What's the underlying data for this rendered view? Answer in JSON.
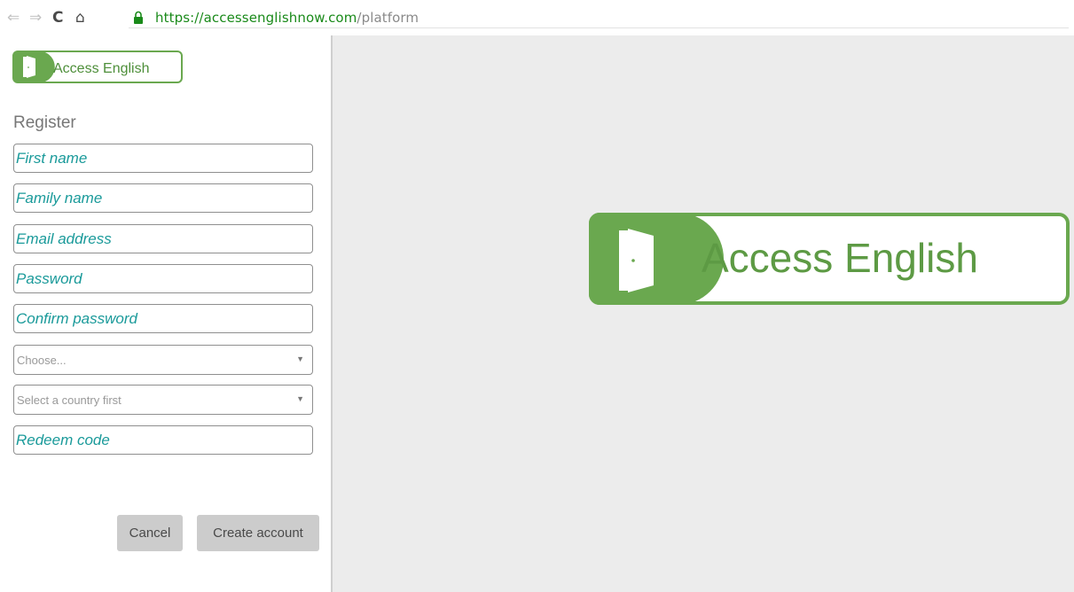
{
  "browser": {
    "url_scheme": "https://",
    "url_host": "accessenglishnow.com",
    "url_path": "/platform"
  },
  "brand": {
    "name": "Access English",
    "color": "#6aa84f"
  },
  "form": {
    "title": "Register",
    "first_name_placeholder": "First name",
    "family_name_placeholder": "Family name",
    "email_placeholder": "Email address",
    "password_placeholder": "Password",
    "confirm_password_placeholder": "Confirm password",
    "country_select": "Choose...",
    "region_select": "Select a country first",
    "redeem_placeholder": "Redeem code",
    "cancel_label": "Cancel",
    "create_label": "Create account"
  },
  "icons": {
    "back": "arrow-left-icon",
    "forward": "arrow-right-icon",
    "reload": "reload-icon",
    "home": "home-icon",
    "lock": "lock-icon",
    "logo": "door-icon"
  }
}
